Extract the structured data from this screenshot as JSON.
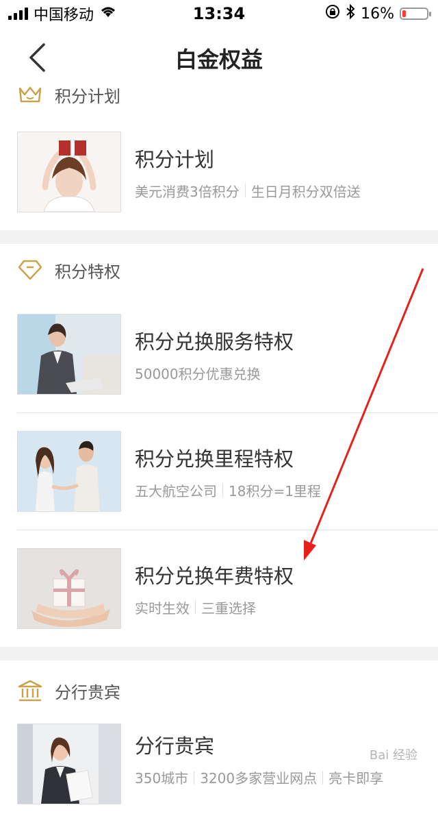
{
  "status_bar": {
    "carrier": "中国移动",
    "time": "13:34",
    "battery": "16%",
    "battery_level": 0.16,
    "battery_color": "#ff3b30",
    "icons": [
      "signal-icon",
      "wifi-icon",
      "orientation-lock-icon",
      "bluetooth-icon",
      "battery-icon"
    ]
  },
  "nav": {
    "title": "白金权益",
    "back_icon": "chevron-left-icon"
  },
  "theme": {
    "accent": "#c9a24c",
    "divider": "#f2f2f2"
  },
  "sections": [
    {
      "title": "积分计划",
      "icon": "crown-icon",
      "items": [
        {
          "title": "积分计划",
          "subs": [
            "美元消费3倍积分",
            "生日月积分双倍送"
          ],
          "image": "woman-holding-gift-photo"
        }
      ]
    },
    {
      "title": "积分特权",
      "icon": "diamond-icon",
      "items": [
        {
          "title": "积分兑换服务特权",
          "subs": [
            "50000积分优惠兑换"
          ],
          "image": "businesswoman-laptop-photo"
        },
        {
          "title": "积分兑换里程特权",
          "subs": [
            "五大航空公司",
            "18积分=1里程"
          ],
          "image": "couple-photo"
        },
        {
          "title": "积分兑换年费特权",
          "subs": [
            "实时生效",
            "三重选择"
          ],
          "image": "gift-in-hands-photo"
        }
      ]
    },
    {
      "title": "分行贵宾",
      "icon": "bank-icon",
      "items": [
        {
          "title": "分行贵宾",
          "subs": [
            "350城市",
            "3200多家营业网点",
            "亮卡即享"
          ],
          "image": "professional-woman-photo"
        }
      ]
    }
  ],
  "watermark": "Bai 经验"
}
